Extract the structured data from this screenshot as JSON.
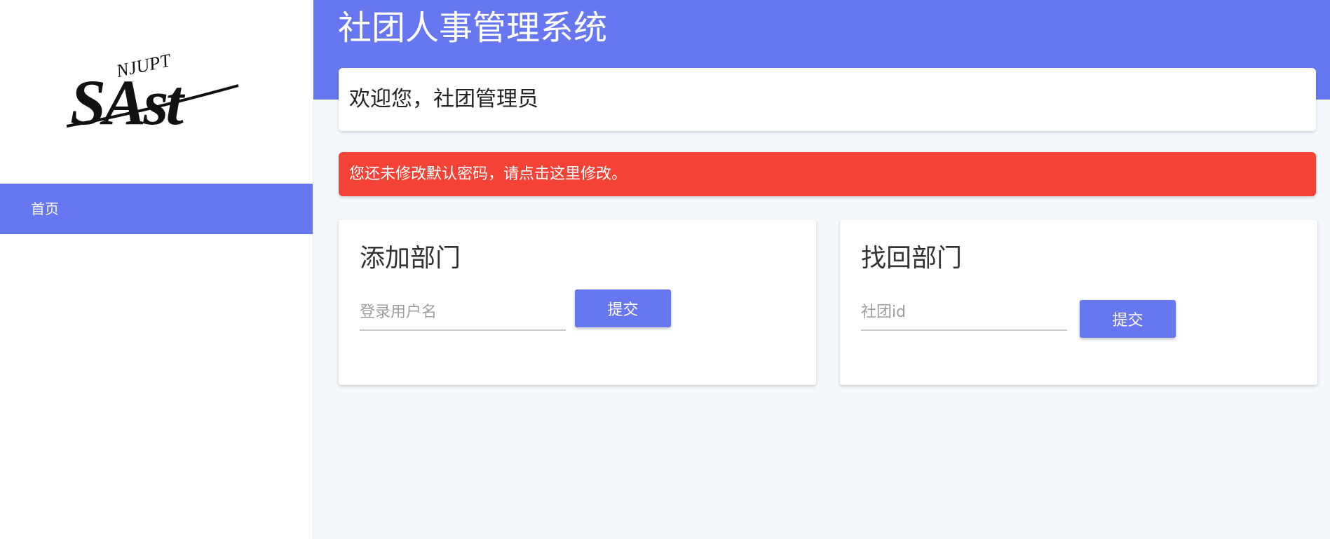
{
  "app": {
    "title": "社团人事管理系统",
    "brand_color": "#6777ef",
    "logo": {
      "icon": "sast-njupt-logo",
      "text_main": "SAst",
      "text_sub": "NJUPT"
    }
  },
  "sidebar": {
    "items": [
      {
        "label": "首页",
        "active": true
      }
    ]
  },
  "welcome": {
    "text": "欢迎您，社团管理员"
  },
  "alert": {
    "text": "您还未修改默认密码，请点击这里修改。",
    "color": "#f44336"
  },
  "cards": {
    "add_department": {
      "title": "添加部门",
      "input_placeholder": "登录用户名",
      "input_value": "",
      "submit_label": "提交"
    },
    "recover_department": {
      "title": "找回部门",
      "input_placeholder": "社团id",
      "input_value": "",
      "submit_label": "提交"
    }
  }
}
